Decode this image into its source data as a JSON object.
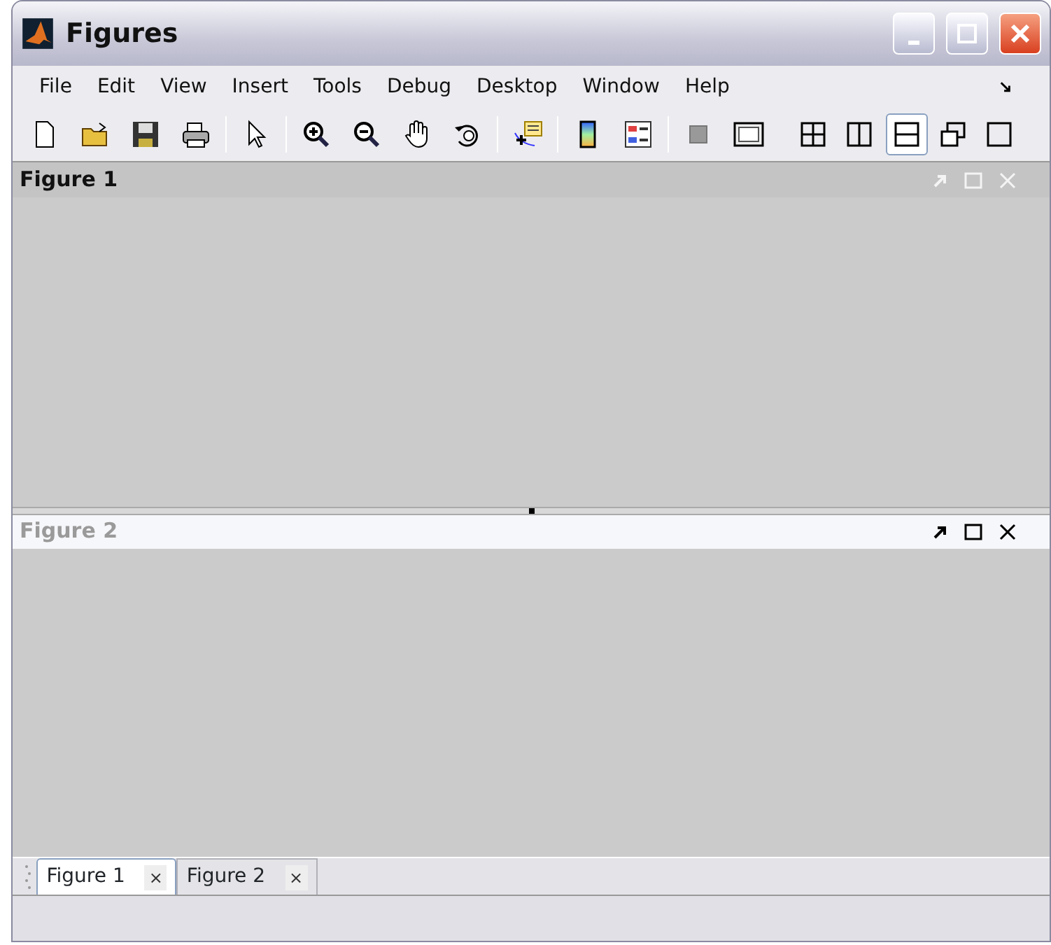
{
  "window": {
    "title": "Figures"
  },
  "menu": [
    {
      "label": "File"
    },
    {
      "label": "Edit"
    },
    {
      "label": "View"
    },
    {
      "label": "Insert"
    },
    {
      "label": "Tools"
    },
    {
      "label": "Debug"
    },
    {
      "label": "Desktop"
    },
    {
      "label": "Window"
    },
    {
      "label": "Help"
    }
  ],
  "toolbar": [
    {
      "kind": "new"
    },
    {
      "kind": "open"
    },
    {
      "kind": "save"
    },
    {
      "kind": "print"
    },
    {
      "kind": "sep"
    },
    {
      "kind": "pointer"
    },
    {
      "kind": "sep"
    },
    {
      "kind": "zoomin"
    },
    {
      "kind": "zoomout"
    },
    {
      "kind": "pan"
    },
    {
      "kind": "rotate"
    },
    {
      "kind": "sep"
    },
    {
      "kind": "datacursor"
    },
    {
      "kind": "sep"
    },
    {
      "kind": "colorbar"
    },
    {
      "kind": "legend"
    },
    {
      "kind": "sep"
    },
    {
      "kind": "hide"
    },
    {
      "kind": "show"
    }
  ],
  "layout_buttons": [
    {
      "kind": "grid",
      "selected": false
    },
    {
      "kind": "cols",
      "selected": false
    },
    {
      "kind": "rows",
      "selected": true
    },
    {
      "kind": "float",
      "selected": false
    },
    {
      "kind": "max",
      "selected": false
    }
  ],
  "panels": [
    {
      "title": "Figure 1",
      "active": true
    },
    {
      "title": "Figure 2",
      "active": false
    }
  ],
  "tabs": [
    {
      "label": "Figure 1",
      "close": "×",
      "selected": true
    },
    {
      "label": "Figure 2",
      "close": "×",
      "selected": false
    }
  ]
}
